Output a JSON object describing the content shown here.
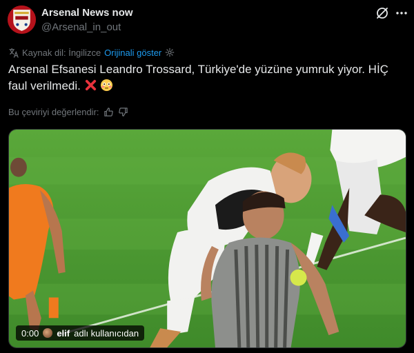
{
  "author": {
    "display_name": "Arsenal News now",
    "handle": "@Arsenal_in_out",
    "avatar_icon": "arsenal-crest-avatar"
  },
  "translation": {
    "source_label": "Kaynak dil: İngilizce",
    "show_original_label": "Orijinali göster"
  },
  "tweet": {
    "text_line_1": "Arsenal Efsanesi Leandro Trossard, Türkiye'de yüzüne yumruk yiyor. HİÇ",
    "text_line_2": "faul verilmedi.",
    "emojis": [
      "cross-mark-emoji",
      "flushed-face-emoji"
    ]
  },
  "rate": {
    "label": "Bu çeviriyi değerlendir:"
  },
  "media": {
    "timestamp": "0:00",
    "credit_user": "elif",
    "credit_suffix": "adlı kullanıcıdan"
  },
  "colors": {
    "background": "#000000",
    "text": "#e7e9ea",
    "muted": "#71767b",
    "link": "#1d9bf0",
    "pitch": "#4f9a34"
  }
}
